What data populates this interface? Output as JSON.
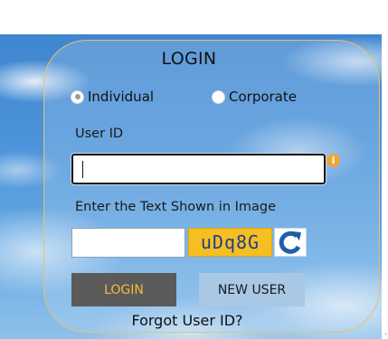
{
  "form": {
    "title": "LOGIN",
    "user_type": {
      "options": [
        "Individual",
        "Corporate"
      ],
      "selected": "Individual"
    },
    "user_id_label": "User ID",
    "user_id_value": "",
    "captcha_label": "Enter the Text Shown in Image",
    "captcha_input_value": "",
    "captcha_text": "uDq8G",
    "login_button": "LOGIN",
    "new_user_button": "NEW USER",
    "forgot_link": "Forgot User ID?"
  },
  "icons": {
    "info": "info-icon",
    "refresh": "refresh-icon"
  },
  "colors": {
    "login_bg": "#5a5a5a",
    "login_text": "#f4b93b",
    "new_user_bg": "#a9c8e6",
    "captcha_bg": "#f5bf22",
    "captcha_text": "#1d3f8f",
    "card_border": "#e3c36a",
    "refresh_icon": "#1f5fa8"
  }
}
